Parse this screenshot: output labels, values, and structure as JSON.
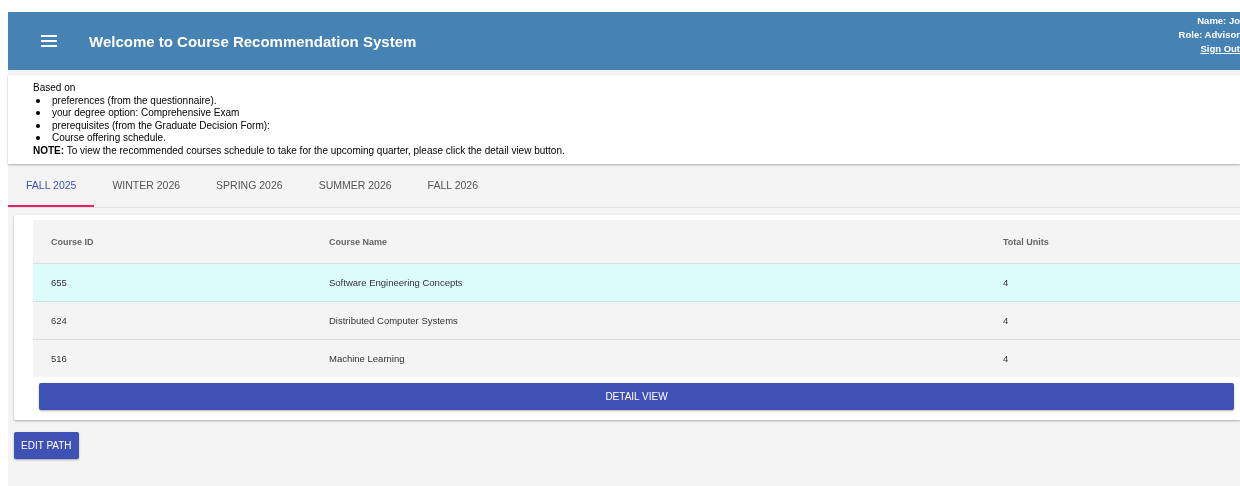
{
  "header": {
    "title": "Welcome to Course Recommendation System",
    "user": [
      "Name: Jo",
      "Role: Advisor"
    ],
    "sign_out": "Sign Out"
  },
  "info": {
    "intro": "Based on",
    "bullets": [
      "preferences (from the questionnaire).",
      "your degree option: Comprehensive Exam",
      "prerequisites (from the Graduate Decision Form):",
      "Course offering schedule."
    ],
    "note": "**NOTE:** To view the recommended courses schedule to take for the upcoming quarter, please click the detail view button."
  },
  "tabs": [
    {
      "label": "FALL 2025",
      "selected": true
    },
    {
      "label": "WINTER 2026",
      "selected": false
    },
    {
      "label": "SPRING 2026",
      "selected": false
    },
    {
      "label": "SUMMER 2026",
      "selected": false
    },
    {
      "label": "FALL 2026",
      "selected": false
    }
  ],
  "table": {
    "columns": [
      "Course ID",
      "Course Name",
      "Total Units"
    ],
    "rows": [
      {
        "cells": [
          "655",
          "Software Engineering Concepts",
          "4"
        ],
        "selected": true
      },
      {
        "cells": [
          "624",
          "Distributed Computer Systems",
          "4"
        ],
        "selected": false
      },
      {
        "cells": [
          "516",
          "Machine Learning",
          "4"
        ],
        "selected": false
      }
    ]
  },
  "buttons": {
    "detail": "DETAIL VIEW",
    "edit": "EDIT PATH"
  }
}
